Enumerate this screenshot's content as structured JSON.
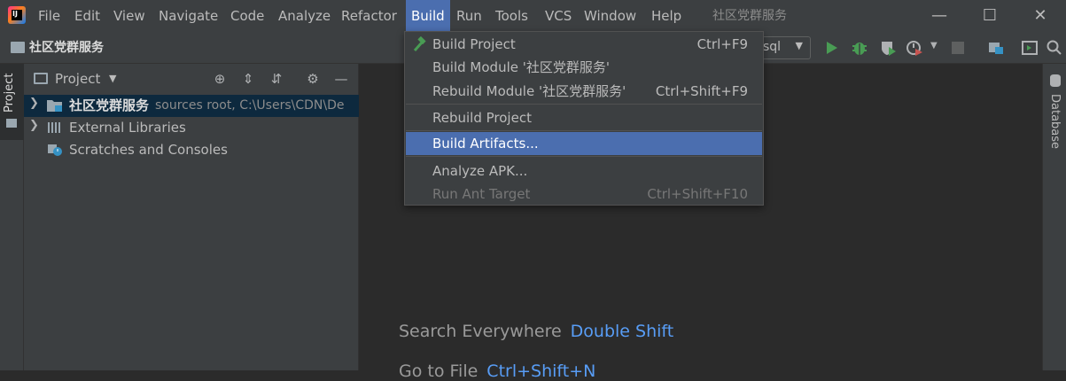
{
  "menubar": {
    "items": [
      "File",
      "Edit",
      "View",
      "Navigate",
      "Code",
      "Analyze",
      "Refactor",
      "Build",
      "Run",
      "Tools",
      "VCS",
      "Window",
      "Help"
    ],
    "title": "社区党群服务"
  },
  "navbar": {
    "breadcrumb": "社区党群服务",
    "run_config": "sql"
  },
  "left_stripe": {
    "tab": "Project"
  },
  "right_stripe": {
    "tab": "Database"
  },
  "project_panel": {
    "title": "Project",
    "rows": [
      {
        "label": "社区党群服务",
        "hint": "sources root,  C:\\Users\\CDN\\De"
      },
      {
        "label": "External Libraries"
      },
      {
        "label": "Scratches and Consoles"
      }
    ]
  },
  "editor": {
    "hint1_label": "Search Everywhere",
    "hint1_key": "Double Shift",
    "hint2_label": "Go to File",
    "hint2_key": "Ctrl+Shift+N"
  },
  "build_menu": {
    "items": [
      {
        "label": "Build Project",
        "shortcut": "Ctrl+F9"
      },
      {
        "label": "Build Module '社区党群服务'",
        "shortcut": ""
      },
      {
        "label": "Rebuild Module '社区党群服务'",
        "shortcut": "Ctrl+Shift+F9"
      },
      {
        "label": "Rebuild Project",
        "shortcut": ""
      },
      {
        "label": "Build Artifacts...",
        "shortcut": ""
      },
      {
        "label": "Analyze APK...",
        "shortcut": ""
      },
      {
        "label": "Run Ant Target",
        "shortcut": "Ctrl+Shift+F10"
      }
    ]
  },
  "colors": {
    "accent": "#4b6eaf",
    "background": "#2b2b2b",
    "panel": "#3c3f41",
    "link": "#589df6"
  }
}
